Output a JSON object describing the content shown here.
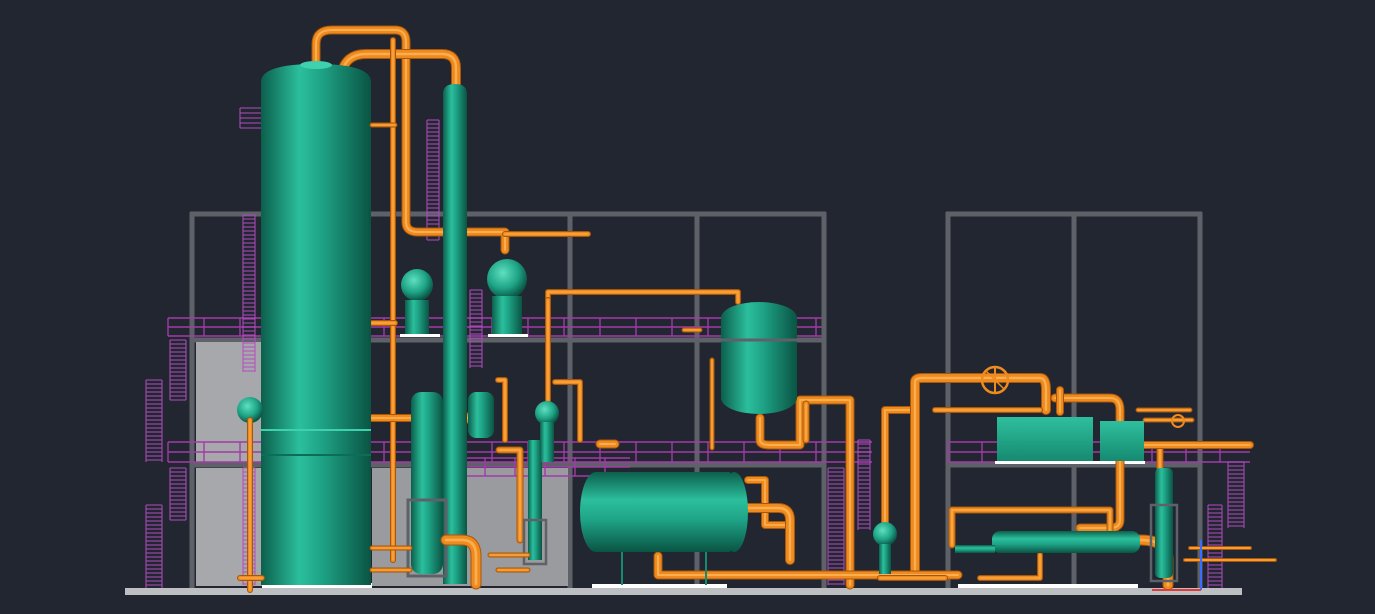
{
  "viewport": {
    "background": "#212630"
  },
  "colors": {
    "vessel": "#1ea386",
    "vessel_light": "#3fd0ae",
    "vessel_dark": "#0d6e58",
    "pipe": "#ee8a1e",
    "pipe_light": "#ffbd64",
    "pipe_dark": "#a8570a",
    "steel": "#5e6168",
    "slab": "#bdbfc2",
    "wall": "#a7a8ab",
    "platform": "#a23aa8",
    "ladder": "#b44cc0"
  },
  "icons": {
    "valve": "valve-handwheel-icon"
  }
}
